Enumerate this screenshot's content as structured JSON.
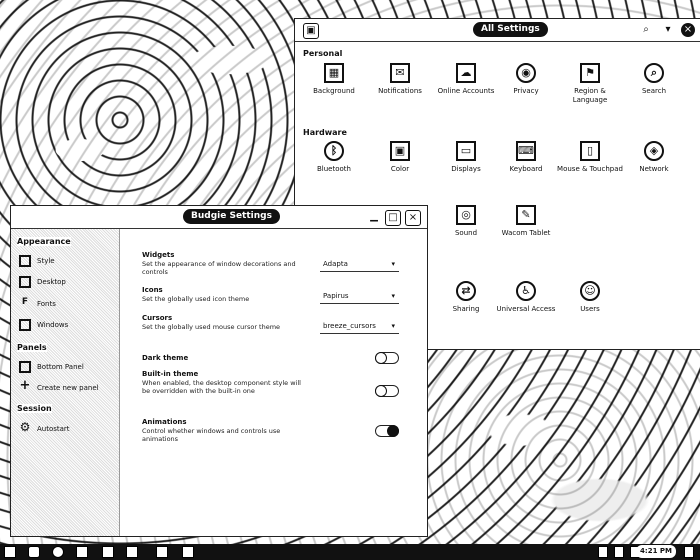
{
  "all_settings": {
    "title": "All Settings",
    "personal_label": "Personal",
    "personal": [
      {
        "label": "Background",
        "icon": "background-icon",
        "glyph": "▦"
      },
      {
        "label": "Notifications",
        "icon": "notifications-icon",
        "glyph": "✉"
      },
      {
        "label": "Online Accounts",
        "icon": "cloud-icon",
        "glyph": "☁"
      },
      {
        "label": "Privacy",
        "icon": "privacy-icon",
        "glyph": "◉"
      },
      {
        "label": "Region & Language",
        "icon": "region-icon",
        "glyph": "⚑"
      },
      {
        "label": "Search",
        "icon": "search-icon",
        "glyph": "⌕"
      }
    ],
    "hardware_label": "Hardware",
    "hardware": [
      {
        "label": "Bluetooth",
        "icon": "bluetooth-icon",
        "glyph": "ᛒ"
      },
      {
        "label": "Color",
        "icon": "color-icon",
        "glyph": "▣"
      },
      {
        "label": "Displays",
        "icon": "display-icon",
        "glyph": "▭"
      },
      {
        "label": "Keyboard",
        "icon": "keyboard-icon",
        "glyph": "⌨"
      },
      {
        "label": "Mouse & Touchpad",
        "icon": "mouse-icon",
        "glyph": "▯"
      },
      {
        "label": "Network",
        "icon": "network-icon",
        "glyph": "◈"
      }
    ],
    "hardware2": [
      {
        "label": "Sound",
        "icon": "sound-icon",
        "glyph": "◎"
      },
      {
        "label": "Wacom Tablet",
        "icon": "tablet-icon",
        "glyph": "✎"
      }
    ],
    "system": [
      {
        "label": "Sharing",
        "icon": "sharing-icon",
        "glyph": "⇄"
      },
      {
        "label": "Universal Access",
        "icon": "accessibility-icon",
        "glyph": "♿"
      },
      {
        "label": "Users",
        "icon": "users-icon",
        "glyph": "☺"
      }
    ]
  },
  "budgie": {
    "title": "Budgie Settings",
    "sidebar": {
      "appearance_label": "Appearance",
      "appearance_items": [
        "Style",
        "Desktop",
        "Fonts",
        "Windows"
      ],
      "panels_label": "Panels",
      "panel_items": [
        "Bottom Panel",
        "Create new panel"
      ],
      "session_label": "Session",
      "session_items": [
        "Autostart"
      ]
    },
    "rows": {
      "widgets_title": "Widgets",
      "widgets_desc": "Set the appearance of window decorations and controls",
      "widgets_value": "Adapta",
      "icons_title": "Icons",
      "icons_desc": "Set the globally used icon theme",
      "icons_value": "Papirus",
      "cursors_title": "Cursors",
      "cursors_desc": "Set the globally used mouse cursor theme",
      "cursors_value": "breeze_cursors",
      "dark_title": "Dark theme",
      "builtin_title": "Built-in theme",
      "builtin_desc": "When enabled, the desktop component style will be overridden with the built-in one",
      "anim_title": "Animations",
      "anim_desc": "Control whether windows and controls use animations"
    }
  },
  "panel": {
    "clock": "4:21 PM"
  }
}
